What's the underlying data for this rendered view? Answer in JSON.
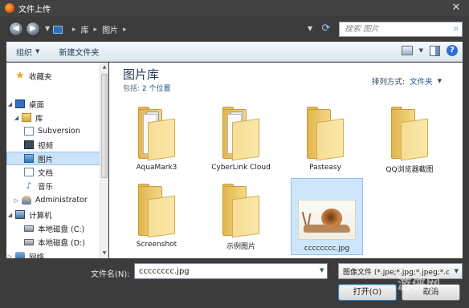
{
  "window": {
    "title": "文件上传",
    "close_glyph": "✕"
  },
  "address": {
    "back_glyph": "◀",
    "forward_glyph": "▶",
    "breadcrumb": [
      "库",
      "图片"
    ],
    "separator": "▸",
    "search_placeholder": "搜索 图片"
  },
  "toolbar": {
    "organize_label": "组织",
    "new_folder_label": "新建文件夹"
  },
  "nav": {
    "items": [
      {
        "label": "收藏夹",
        "icon": "star-icon"
      },
      {
        "label": "桌面",
        "icon": "desktop-icon"
      },
      {
        "label": "库",
        "icon": "library-icon"
      },
      {
        "label": "Subversion",
        "icon": "document-icon"
      },
      {
        "label": "视频",
        "icon": "video-icon"
      },
      {
        "label": "图片",
        "icon": "pictures-icon",
        "selected": true
      },
      {
        "label": "文档",
        "icon": "document-icon"
      },
      {
        "label": "音乐",
        "icon": "music-icon"
      },
      {
        "label": "Administrator",
        "icon": "user-icon"
      },
      {
        "label": "计算机",
        "icon": "computer-icon"
      },
      {
        "label": "本地磁盘 (C:)",
        "icon": "disk-icon"
      },
      {
        "label": "本地磁盘 (D:)",
        "icon": "disk-icon"
      },
      {
        "label": "网络",
        "icon": "network-icon"
      }
    ]
  },
  "content": {
    "library_title": "图片库",
    "includes_label": "包括:",
    "includes_count": "2 个位置",
    "arrange_label": "排列方式:",
    "arrange_value": "文件夹",
    "items": [
      {
        "label": "AquaMark3",
        "type": "folder",
        "variant": "papers"
      },
      {
        "label": "CyberLink Cloud",
        "type": "folder",
        "variant": "papers2"
      },
      {
        "label": "Pasteasy",
        "type": "folder",
        "variant": "plain"
      },
      {
        "label": "QQ浏览器截图",
        "type": "folder",
        "variant": "plain"
      },
      {
        "label": "Screenshot",
        "type": "folder",
        "variant": "plain"
      },
      {
        "label": "示例图片",
        "type": "folder",
        "variant": "plain"
      },
      {
        "label": "cccccccc.jpg",
        "type": "image",
        "selected": true
      }
    ]
  },
  "footer": {
    "filename_label": "文件名(N):",
    "filename_value": "cccccccc.jpg",
    "filter_label": "图像文件 (*.jpe;*.jpg;*.jpeg;*.c",
    "open_label": "打开(O)",
    "cancel_label": "取消"
  },
  "watermark": "游侠网",
  "colors": {
    "chrome_dark": "#3c3c3c",
    "selection": "#cde6fb",
    "folder_yellow": "#f3d886"
  }
}
